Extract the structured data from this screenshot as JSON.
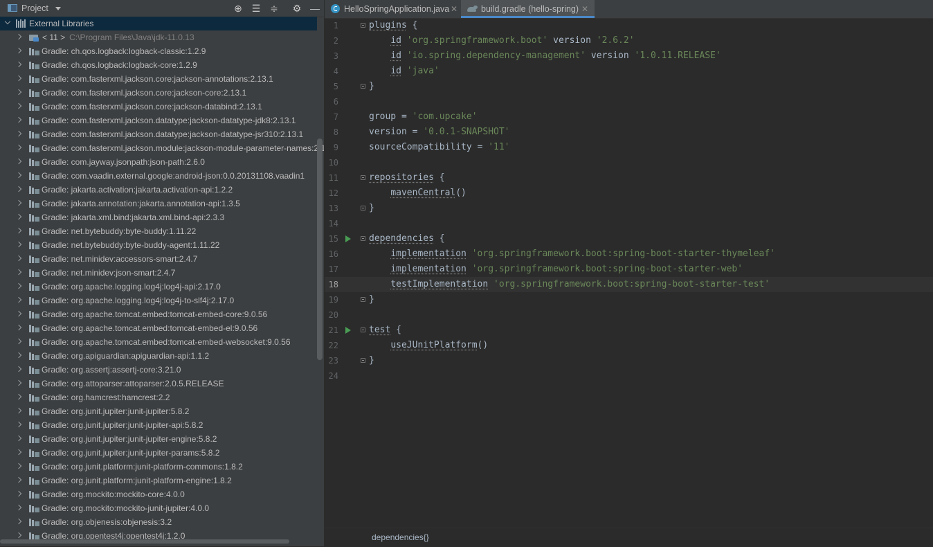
{
  "project_panel": {
    "title": "Project",
    "toolbar_icons": [
      "locate-icon",
      "expand-all-icon",
      "collapse-all-icon",
      "gear-icon",
      "minimize-icon"
    ],
    "root": {
      "label": "External Libraries"
    },
    "jdk": {
      "label": "< 11 >",
      "path": "C:\\Program Files\\Java\\jdk-11.0.13"
    },
    "libraries": [
      "Gradle: ch.qos.logback:logback-classic:1.2.9",
      "Gradle: ch.qos.logback:logback-core:1.2.9",
      "Gradle: com.fasterxml.jackson.core:jackson-annotations:2.13.1",
      "Gradle: com.fasterxml.jackson.core:jackson-core:2.13.1",
      "Gradle: com.fasterxml.jackson.core:jackson-databind:2.13.1",
      "Gradle: com.fasterxml.jackson.datatype:jackson-datatype-jdk8:2.13.1",
      "Gradle: com.fasterxml.jackson.datatype:jackson-datatype-jsr310:2.13.1",
      "Gradle: com.fasterxml.jackson.module:jackson-module-parameter-names:2.1",
      "Gradle: com.jayway.jsonpath:json-path:2.6.0",
      "Gradle: com.vaadin.external.google:android-json:0.0.20131108.vaadin1",
      "Gradle: jakarta.activation:jakarta.activation-api:1.2.2",
      "Gradle: jakarta.annotation:jakarta.annotation-api:1.3.5",
      "Gradle: jakarta.xml.bind:jakarta.xml.bind-api:2.3.3",
      "Gradle: net.bytebuddy:byte-buddy:1.11.22",
      "Gradle: net.bytebuddy:byte-buddy-agent:1.11.22",
      "Gradle: net.minidev:accessors-smart:2.4.7",
      "Gradle: net.minidev:json-smart:2.4.7",
      "Gradle: org.apache.logging.log4j:log4j-api:2.17.0",
      "Gradle: org.apache.logging.log4j:log4j-to-slf4j:2.17.0",
      "Gradle: org.apache.tomcat.embed:tomcat-embed-core:9.0.56",
      "Gradle: org.apache.tomcat.embed:tomcat-embed-el:9.0.56",
      "Gradle: org.apache.tomcat.embed:tomcat-embed-websocket:9.0.56",
      "Gradle: org.apiguardian:apiguardian-api:1.1.2",
      "Gradle: org.assertj:assertj-core:3.21.0",
      "Gradle: org.attoparser:attoparser:2.0.5.RELEASE",
      "Gradle: org.hamcrest:hamcrest:2.2",
      "Gradle: org.junit.jupiter:junit-jupiter:5.8.2",
      "Gradle: org.junit.jupiter:junit-jupiter-api:5.8.2",
      "Gradle: org.junit.jupiter:junit-jupiter-engine:5.8.2",
      "Gradle: org.junit.jupiter:junit-jupiter-params:5.8.2",
      "Gradle: org.junit.platform:junit-platform-commons:1.8.2",
      "Gradle: org.junit.platform:junit-platform-engine:1.8.2",
      "Gradle: org.mockito:mockito-core:4.0.0",
      "Gradle: org.mockito:mockito-junit-jupiter:4.0.0",
      "Gradle: org.objenesis:objenesis:3.2",
      "Gradle: org.opentest4j:opentest4j:1.2.0"
    ]
  },
  "editor": {
    "tabs": [
      {
        "label": "HelloSpringApplication.java",
        "icon": "java-class-icon",
        "active": false
      },
      {
        "label": "build.gradle (hello-spring)",
        "icon": "gradle-icon",
        "active": true
      }
    ],
    "current_line": 18,
    "lines": [
      {
        "n": "1",
        "tokens": [
          [
            "kw",
            "plugins"
          ],
          [
            "pl",
            " {"
          ]
        ],
        "fold": true
      },
      {
        "n": "2",
        "tokens": [
          [
            "pl",
            "    "
          ],
          [
            "kw",
            "id"
          ],
          [
            "pl",
            " "
          ],
          [
            "str",
            "'org.springframework.boot'"
          ],
          [
            "pl",
            " version "
          ],
          [
            "str",
            "'2.6.2'"
          ]
        ]
      },
      {
        "n": "3",
        "tokens": [
          [
            "pl",
            "    "
          ],
          [
            "kw",
            "id"
          ],
          [
            "pl",
            " "
          ],
          [
            "str",
            "'io.spring.dependency-management'"
          ],
          [
            "pl",
            " version "
          ],
          [
            "str",
            "'1.0.11.RELEASE'"
          ]
        ]
      },
      {
        "n": "4",
        "tokens": [
          [
            "pl",
            "    "
          ],
          [
            "kw",
            "id"
          ],
          [
            "pl",
            " "
          ],
          [
            "str",
            "'java'"
          ]
        ]
      },
      {
        "n": "5",
        "tokens": [
          [
            "pl",
            "}"
          ]
        ],
        "fold": true
      },
      {
        "n": "6",
        "tokens": []
      },
      {
        "n": "7",
        "tokens": [
          [
            "pl",
            "group = "
          ],
          [
            "str",
            "'com.upcake'"
          ]
        ]
      },
      {
        "n": "8",
        "tokens": [
          [
            "pl",
            "version = "
          ],
          [
            "str",
            "'0.0.1-SNAPSHOT'"
          ]
        ]
      },
      {
        "n": "9",
        "tokens": [
          [
            "pl",
            "sourceCompatibility = "
          ],
          [
            "str",
            "'11'"
          ]
        ]
      },
      {
        "n": "10",
        "tokens": []
      },
      {
        "n": "11",
        "tokens": [
          [
            "kw",
            "repositories"
          ],
          [
            "pl",
            " {"
          ]
        ],
        "fold": true
      },
      {
        "n": "12",
        "tokens": [
          [
            "pl",
            "    "
          ],
          [
            "kw",
            "mavenCentral"
          ],
          [
            "pl",
            "()"
          ]
        ]
      },
      {
        "n": "13",
        "tokens": [
          [
            "pl",
            "}"
          ]
        ],
        "fold": true
      },
      {
        "n": "14",
        "tokens": []
      },
      {
        "n": "15",
        "tokens": [
          [
            "kw",
            "dependencies"
          ],
          [
            "pl",
            " {"
          ]
        ],
        "fold": true,
        "run": true
      },
      {
        "n": "16",
        "tokens": [
          [
            "pl",
            "    "
          ],
          [
            "kw",
            "implementation"
          ],
          [
            "pl",
            " "
          ],
          [
            "str",
            "'org.springframework.boot:spring-boot-starter-thymeleaf'"
          ]
        ]
      },
      {
        "n": "17",
        "tokens": [
          [
            "pl",
            "    "
          ],
          [
            "kw",
            "implementation"
          ],
          [
            "pl",
            " "
          ],
          [
            "str",
            "'org.springframework.boot:spring-boot-starter-web'"
          ]
        ]
      },
      {
        "n": "18",
        "tokens": [
          [
            "pl",
            "    "
          ],
          [
            "kw",
            "testImplementation"
          ],
          [
            "pl",
            " "
          ],
          [
            "str",
            "'org.springframework.boot:spring-boot-starter-test'"
          ]
        ]
      },
      {
        "n": "19",
        "tokens": [
          [
            "pl",
            "}"
          ]
        ],
        "fold": true
      },
      {
        "n": "20",
        "tokens": []
      },
      {
        "n": "21",
        "tokens": [
          [
            "kw",
            "test"
          ],
          [
            "pl",
            " {"
          ]
        ],
        "fold": true,
        "run": true
      },
      {
        "n": "22",
        "tokens": [
          [
            "pl",
            "    "
          ],
          [
            "kw",
            "useJUnitPlatform"
          ],
          [
            "pl",
            "()"
          ]
        ]
      },
      {
        "n": "23",
        "tokens": [
          [
            "pl",
            "}"
          ]
        ],
        "fold": true
      },
      {
        "n": "24",
        "tokens": []
      }
    ],
    "breadcrumb": "dependencies{}"
  }
}
